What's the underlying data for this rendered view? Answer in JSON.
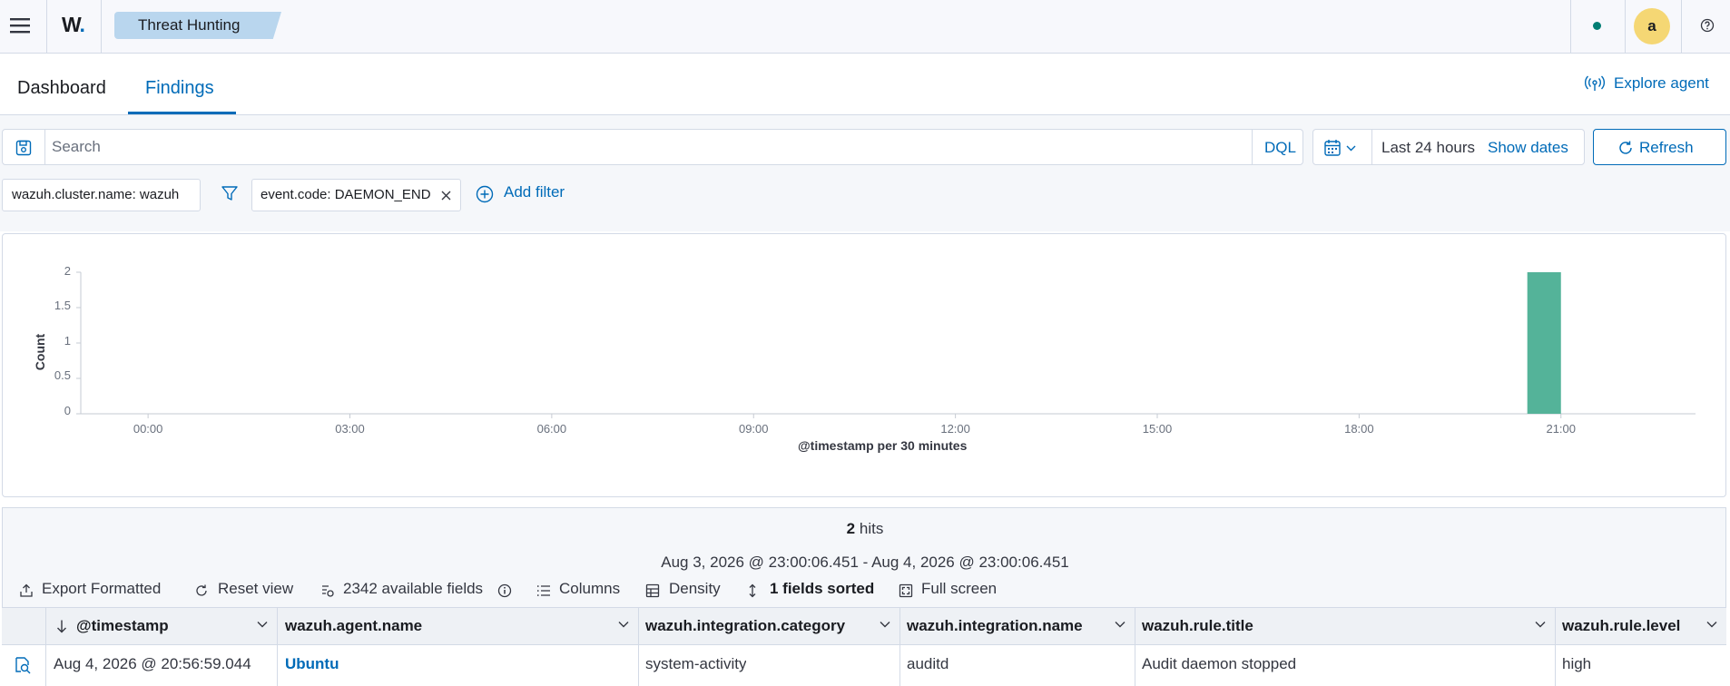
{
  "topbar": {
    "logo_text": "W",
    "logo_dot": ".",
    "breadcrumb": "Threat Hunting",
    "avatar_letter": "a",
    "status_color": "#017d73"
  },
  "tabs": [
    {
      "label": "Dashboard",
      "active": false
    },
    {
      "label": "Findings",
      "active": true
    }
  ],
  "explore_agent_label": "Explore agent",
  "search": {
    "placeholder": "Search",
    "value": "",
    "language": "DQL"
  },
  "datepicker": {
    "range_label": "Last 24 hours",
    "show_dates_label": "Show dates"
  },
  "refresh_label": "Refresh",
  "filters": [
    {
      "label": "wazuh.cluster.name: wazuh",
      "removable": false
    },
    {
      "label": "event.code: DAEMON_END",
      "removable": true
    }
  ],
  "add_filter_label": "Add filter",
  "chart_data": {
    "type": "bar",
    "xlabel": "@timestamp per 30 minutes",
    "ylabel": "Count",
    "ylim": [
      0,
      2
    ],
    "yticks": [
      "0",
      "0.5",
      "1",
      "1.5",
      "2"
    ],
    "xticks": [
      "00:00",
      "03:00",
      "06:00",
      "09:00",
      "12:00",
      "15:00",
      "18:00",
      "21:00"
    ],
    "x_range_hours": [
      -1,
      23
    ],
    "bars": [
      {
        "start_hour": 20.5,
        "end_hour": 21.0,
        "value": 2
      }
    ],
    "bar_color": "#54b399",
    "grid": false,
    "legend": "none"
  },
  "results": {
    "hits_count": "2",
    "hits_label": "hits",
    "time_range": "Aug 3, 2026 @ 23:00:06.451 - Aug 4, 2026 @ 23:00:06.451",
    "toolbar": {
      "export": "Export Formatted",
      "reset": "Reset view",
      "fields": "2342 available fields",
      "columns": "Columns",
      "density": "Density",
      "sorted": "1 fields sorted",
      "fullscreen": "Full screen"
    },
    "columns": [
      "@timestamp",
      "wazuh.agent.name",
      "wazuh.integration.category",
      "wazuh.integration.name",
      "wazuh.rule.title",
      "wazuh.rule.level"
    ],
    "rows": [
      [
        "Aug 4, 2026 @ 20:56:59.044",
        "Ubuntu",
        "system-activity",
        "auditd",
        "Audit daemon stopped",
        "high"
      ]
    ]
  }
}
